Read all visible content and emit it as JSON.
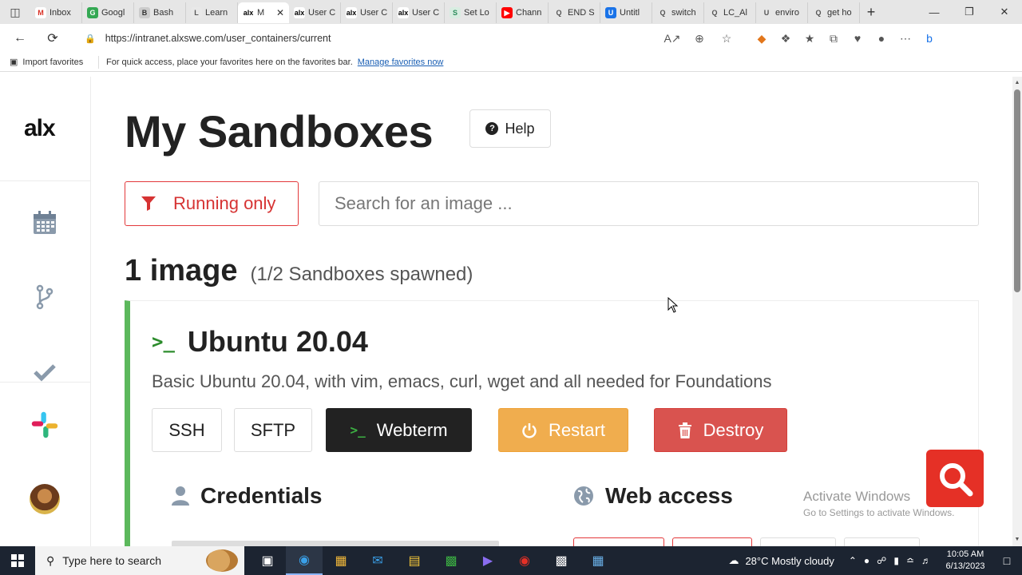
{
  "browser": {
    "tabs": [
      {
        "label": "Inbox",
        "fav_color": "#ffffff",
        "fav_text": "M",
        "fav_fg": "#d93025"
      },
      {
        "label": "Googl",
        "fav_color": "#34a853",
        "fav_text": "G",
        "fav_fg": "#ffffff"
      },
      {
        "label": "Bash",
        "fav_color": "#cccccc",
        "fav_text": "B",
        "fav_fg": "#333333"
      },
      {
        "label": "Learn",
        "fav_color": "#e8e8e8",
        "fav_text": "L",
        "fav_fg": "#555555"
      },
      {
        "label": "M",
        "fav_color": "#ffffff",
        "fav_text": "alx",
        "fav_fg": "#000000",
        "active": true
      },
      {
        "label": "User C",
        "fav_color": "#ffffff",
        "fav_text": "alx",
        "fav_fg": "#000000"
      },
      {
        "label": "User C",
        "fav_color": "#ffffff",
        "fav_text": "alx",
        "fav_fg": "#000000"
      },
      {
        "label": "User C",
        "fav_color": "#ffffff",
        "fav_text": "alx",
        "fav_fg": "#000000"
      },
      {
        "label": "Set Lo",
        "fav_color": "#d8ede1",
        "fav_text": "S",
        "fav_fg": "#2a8c5a"
      },
      {
        "label": "Chann",
        "fav_color": "#ff0000",
        "fav_text": "▶",
        "fav_fg": "#ffffff"
      },
      {
        "label": "END S",
        "fav_color": "#e6e6e6",
        "fav_text": "Q",
        "fav_fg": "#555555"
      },
      {
        "label": "Untitl",
        "fav_color": "#1a73e8",
        "fav_text": "U",
        "fav_fg": "#ffffff"
      },
      {
        "label": "switch",
        "fav_color": "#e6e6e6",
        "fav_text": "Q",
        "fav_fg": "#555555"
      },
      {
        "label": "LC_Al",
        "fav_color": "#e6e6e6",
        "fav_text": "Q",
        "fav_fg": "#555555"
      },
      {
        "label": "enviro",
        "fav_color": "#e6e6e6",
        "fav_text": "U",
        "fav_fg": "#555555"
      },
      {
        "label": "get ho",
        "fav_color": "#e6e6e6",
        "fav_text": "Q",
        "fav_fg": "#555555"
      }
    ],
    "url": "https://intranet.alxswe.com/user_containers/current",
    "favbar": {
      "import": "Import favorites",
      "hint": "For quick access, place your favorites here on the favorites bar.",
      "manage": "Manage favorites now"
    }
  },
  "sidebar": {
    "logo": "alx",
    "icons": [
      "calendar-icon",
      "git-branch-icon",
      "check-icon",
      "slack-icon"
    ]
  },
  "page": {
    "title": "My Sandboxes",
    "help_label": "Help",
    "filter_label": "Running only",
    "search_placeholder": "Search for an image ...",
    "count_main": "1 image",
    "count_sub": "(1/2 Sandboxes spawned)"
  },
  "sandbox": {
    "name": "Ubuntu 20.04",
    "description": "Basic Ubuntu 20.04, with vim, emacs, curl, wget and all needed for Foundations",
    "buttons": {
      "ssh": "SSH",
      "sftp": "SFTP",
      "webterm": "Webterm",
      "restart": "Restart",
      "destroy": "Destroy"
    },
    "credentials_title": "Credentials",
    "web_access_title": "Web access",
    "status_color": "#5cb85c"
  },
  "overlay": {
    "activate_title": "Activate Windows",
    "activate_sub": "Go to Settings to activate Windows."
  },
  "taskbar": {
    "search_placeholder": "Type here to search",
    "weather": "28°C  Mostly cloudy",
    "time": "10:05 AM",
    "date": "6/13/2023"
  }
}
